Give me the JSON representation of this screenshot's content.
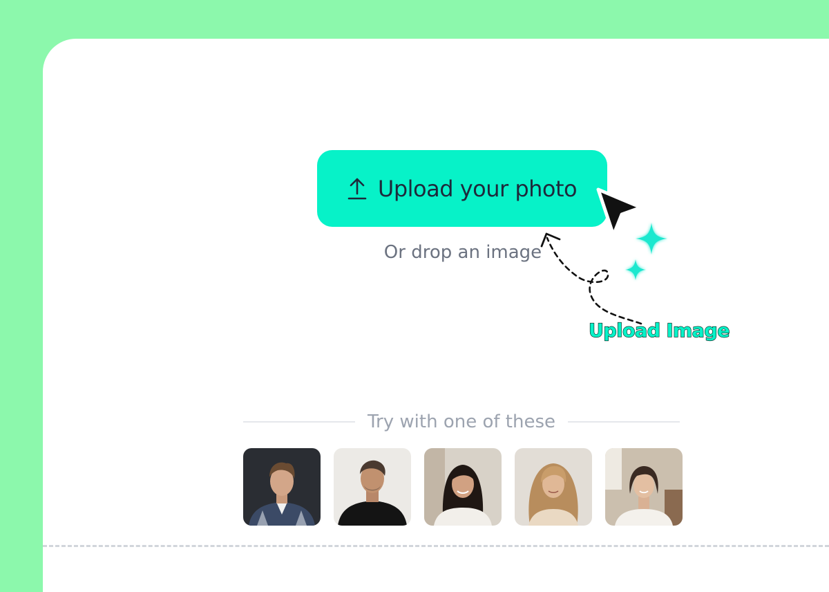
{
  "upload": {
    "button_label": "Upload your photo",
    "icon": "upload-arrow-icon",
    "drop_text": "Or drop an image"
  },
  "annotation": {
    "label": "Upload Image",
    "cursor_icon": "pointer-cursor-icon",
    "sparkle_icon": "sparkle-icon"
  },
  "samples": {
    "heading": "Try with one of these",
    "items": [
      {
        "icon": "sample-photo-1"
      },
      {
        "icon": "sample-photo-2"
      },
      {
        "icon": "sample-photo-3"
      },
      {
        "icon": "sample-photo-4"
      },
      {
        "icon": "sample-photo-5"
      }
    ]
  },
  "colors": {
    "background": "#8cf8ac",
    "accent": "#07f2c8",
    "panel": "#ffffff"
  }
}
